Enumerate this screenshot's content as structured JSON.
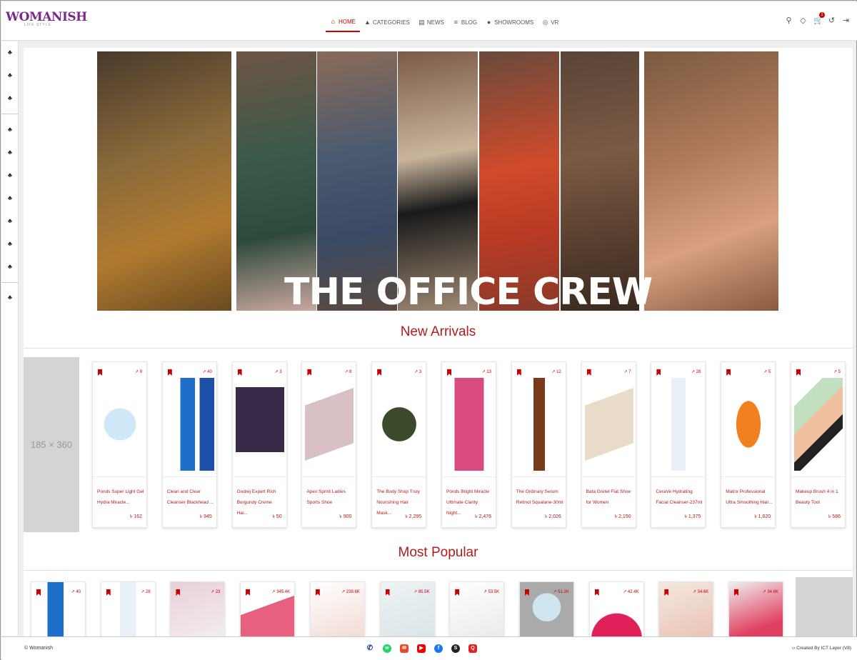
{
  "header": {
    "brand": "WOMANISH",
    "tagline": "LIFE STYLE",
    "nav": [
      {
        "label": "HOME",
        "icon": "home-icon"
      },
      {
        "label": "CATEGORIES",
        "icon": "categories-icon"
      },
      {
        "label": "NEWS",
        "icon": "news-icon"
      },
      {
        "label": "BLOG",
        "icon": "blog-icon"
      },
      {
        "label": "SHOWROOMS",
        "icon": "location-icon"
      },
      {
        "label": "VR",
        "icon": "vr-icon"
      }
    ],
    "cart_count": "1"
  },
  "hero": {
    "title": "THE OFFICE CREW"
  },
  "sections": {
    "new_arrivals": "New Arrivals",
    "most_popular": "Most Popular"
  },
  "placeholder": "185 × 360",
  "new_arrivals": [
    {
      "name": "Ponds Super Light Gel Hydra Miracle...",
      "price": "৳ 162",
      "trend": "9"
    },
    {
      "name": "Clean and Clear Cleanser Blackhead ...",
      "price": "৳ 945",
      "trend": "40"
    },
    {
      "name": "Godrej Expert Rich Burgundy Creme Hai...",
      "price": "৳ 50",
      "trend": "3"
    },
    {
      "name": "Apex Sprint Ladies Sports Shoe",
      "price": "৳ 900",
      "trend": "8"
    },
    {
      "name": "The Body Shop Truly Nourishing Hair Mask...",
      "price": "৳ 2,295",
      "trend": "3"
    },
    {
      "name": "Ponds Bright Miracle Ultimate Clarity Night...",
      "price": "৳ 2,476",
      "trend": "13"
    },
    {
      "name": "The Ordinary Serum Retinol Squalane-30ml",
      "price": "৳ 2,026",
      "trend": "12"
    },
    {
      "name": "Bata Gretel Flat Shoe for Women",
      "price": "৳ 2,150",
      "trend": "7"
    },
    {
      "name": "CeraVe Hydrating Facial Cleanser-237ml",
      "price": "৳ 1,375",
      "trend": "28"
    },
    {
      "name": "Matrix Professional Ultra Smoothing Hair...",
      "price": "৳ 1,620",
      "trend": "5"
    },
    {
      "name": "Makeup Brush 4 in 1 Beauty Tool",
      "price": "৳ 586",
      "trend": "5"
    }
  ],
  "most_popular": [
    {
      "trend": "40"
    },
    {
      "trend": "28"
    },
    {
      "trend": "23"
    },
    {
      "trend": "345.4K"
    },
    {
      "trend": "238.6K"
    },
    {
      "trend": "85.5K"
    },
    {
      "trend": "53.5K"
    },
    {
      "trend": "51.2K"
    },
    {
      "trend": "42.4K"
    },
    {
      "trend": "34.6K"
    },
    {
      "trend": "34.6K"
    }
  ],
  "footer": {
    "copyright": "Womanish",
    "credit": "Created By ICT Layer (V8)"
  },
  "colors": {
    "accent": "#b21b1b",
    "brand": "#7b2a8c"
  }
}
